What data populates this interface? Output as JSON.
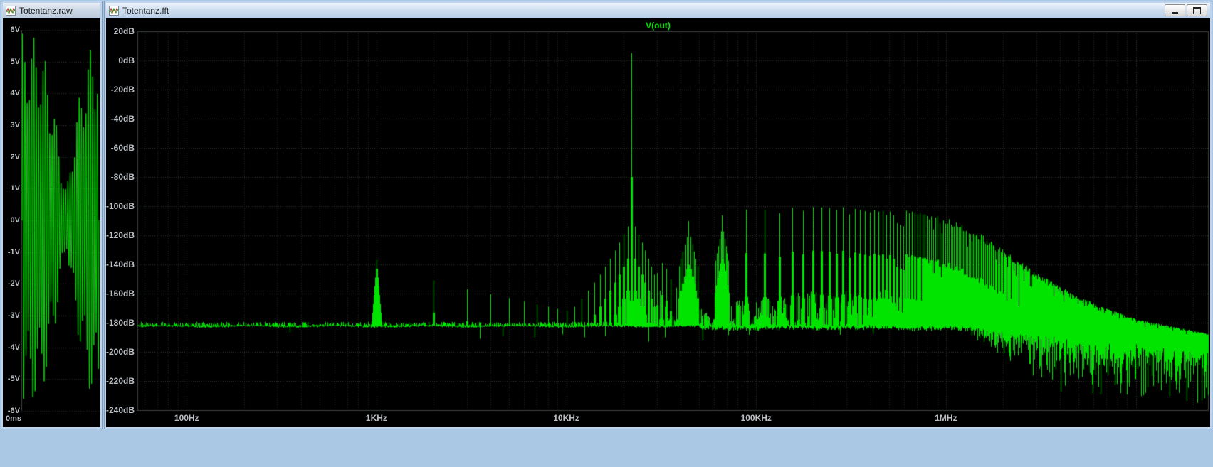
{
  "app": {
    "background_color": "#aac8e4",
    "trace_color": "#00e400"
  },
  "windows": [
    {
      "id": "raw",
      "title": "Totentanz.raw",
      "icon": "waveform-icon",
      "controls": []
    },
    {
      "id": "fft",
      "title": "Totentanz.fft",
      "icon": "waveform-icon",
      "controls": [
        "minimize",
        "maximize"
      ]
    }
  ],
  "chart_data": [
    {
      "type": "line",
      "window": "Totentanz.raw",
      "title": "",
      "trace_color": "#00e400",
      "y_ticks": [
        "6V",
        "5V",
        "4V",
        "3V",
        "2V",
        "1V",
        "0V",
        "-1V",
        "-2V",
        "-3V",
        "-4V",
        "-5V",
        "-6V"
      ],
      "y_range_volts": [
        -6,
        6
      ],
      "x_ticks": [
        "0ms"
      ],
      "waveform": {
        "description": "dense amplitude-modulated audio waveform filling the pane, amplitude near 6V at both ends with a pinch just past the middle",
        "cycles_visible": 34,
        "envelope_t": [
          0,
          0.1,
          0.25,
          0.4,
          0.5,
          0.58,
          0.66,
          0.8,
          0.92,
          1.0
        ],
        "envelope_v": [
          5.9,
          5.85,
          5.6,
          4.0,
          2.0,
          0.9,
          2.6,
          4.8,
          5.7,
          5.9
        ]
      }
    },
    {
      "type": "line",
      "window": "Totentanz.fft",
      "title": "V(out)",
      "trace_color": "#00e400",
      "grid_color": "#333b33",
      "x_scale": "log",
      "x_range_hz": [
        55,
        24000000
      ],
      "x_ticks": [
        {
          "f": 100,
          "label": "100Hz"
        },
        {
          "f": 1000,
          "label": "1KHz"
        },
        {
          "f": 10000,
          "label": "10KHz"
        },
        {
          "f": 100000,
          "label": "100KHz"
        },
        {
          "f": 1000000,
          "label": "1MHz"
        }
      ],
      "y_ticks": [
        {
          "db": 20,
          "label": "20dB"
        },
        {
          "db": 0,
          "label": "0dB"
        },
        {
          "db": -20,
          "label": "-20dB"
        },
        {
          "db": -40,
          "label": "-40dB"
        },
        {
          "db": -60,
          "label": "-60dB"
        },
        {
          "db": -80,
          "label": "-80dB"
        },
        {
          "db": -100,
          "label": "-100dB"
        },
        {
          "db": -120,
          "label": "-120dB"
        },
        {
          "db": -140,
          "label": "-140dB"
        },
        {
          "db": -160,
          "label": "-160dB"
        },
        {
          "db": -180,
          "label": "-180dB"
        },
        {
          "db": -200,
          "label": "-200dB"
        },
        {
          "db": -220,
          "label": "-220dB"
        },
        {
          "db": -240,
          "label": "-240dB"
        }
      ],
      "y_range_db": [
        -240,
        20
      ],
      "noise_floor_db": -182.3,
      "fundamental": {
        "f_hz": 1000,
        "db": -137
      },
      "harmonics_1khz": [
        [
          2000,
          -151
        ],
        [
          3000,
          -157
        ],
        [
          4000,
          -160.5
        ],
        [
          5000,
          -163
        ],
        [
          6000,
          -165.5
        ],
        [
          7000,
          -167.5
        ],
        [
          8000,
          -169
        ],
        [
          9000,
          -170.5
        ],
        [
          10000,
          -171.5
        ],
        [
          11000,
          -172.5
        ],
        [
          12000,
          -173.5
        ],
        [
          13000,
          -174.5
        ],
        [
          14000,
          -175
        ],
        [
          15000,
          -175.5
        ],
        [
          16000,
          -176
        ],
        [
          17000,
          -176.5
        ],
        [
          18000,
          -177
        ],
        [
          19000,
          -177.5
        ],
        [
          20000,
          -178
        ],
        [
          21000,
          -178.5
        ]
      ],
      "carrier": {
        "f_hz": 22050,
        "db": 5
      },
      "carrier_sidebands": {
        "spacing_hz": 1000,
        "count": 12,
        "start_db": -114,
        "step_db": -5.5
      },
      "extra_peaks": [
        [
          26000,
          -158
        ],
        [
          28000,
          -152
        ],
        [
          30000,
          -146
        ],
        [
          32000,
          -139
        ],
        [
          33500,
          -143
        ],
        [
          35500,
          -150
        ],
        [
          38000,
          -156
        ]
      ],
      "image_comb": {
        "spacing_hz": 22050,
        "jitter_db": 5,
        "envelope_log": [
          [
            44100,
            -112
          ],
          [
            66150,
            -105
          ],
          [
            100000,
            -103.5
          ],
          [
            200000,
            -102.5
          ],
          [
            400000,
            -103.5
          ],
          [
            700000,
            -106
          ],
          [
            1000000,
            -110
          ],
          [
            1400000,
            -118
          ],
          [
            2000000,
            -132
          ],
          [
            3000000,
            -148
          ],
          [
            5000000,
            -165
          ],
          [
            10000000,
            -180
          ],
          [
            24000000,
            -190
          ]
        ]
      },
      "grass_envelope": [
        [
          24000,
          3
        ],
        [
          40000,
          8
        ],
        [
          60000,
          14
        ],
        [
          100000,
          20
        ],
        [
          200000,
          24
        ],
        [
          500000,
          26
        ],
        [
          1000000,
          24
        ],
        [
          1500000,
          18
        ],
        [
          2500000,
          10
        ]
      ],
      "notches": [
        [
          350,
          -186.5
        ],
        [
          3500,
          -191
        ],
        [
          4600,
          -189
        ],
        [
          6800,
          -190
        ],
        [
          9500,
          -188
        ],
        [
          12500,
          -190
        ],
        [
          16000,
          -189
        ],
        [
          27000,
          -193
        ],
        [
          33000,
          -190
        ],
        [
          52000,
          -192
        ]
      ],
      "high_freq_fuzz": {
        "start_hz": 1100000,
        "full_hz": 3500000,
        "spread_up_db": 10,
        "spread_down_db": 42,
        "floor_drop_db": 18
      }
    }
  ]
}
